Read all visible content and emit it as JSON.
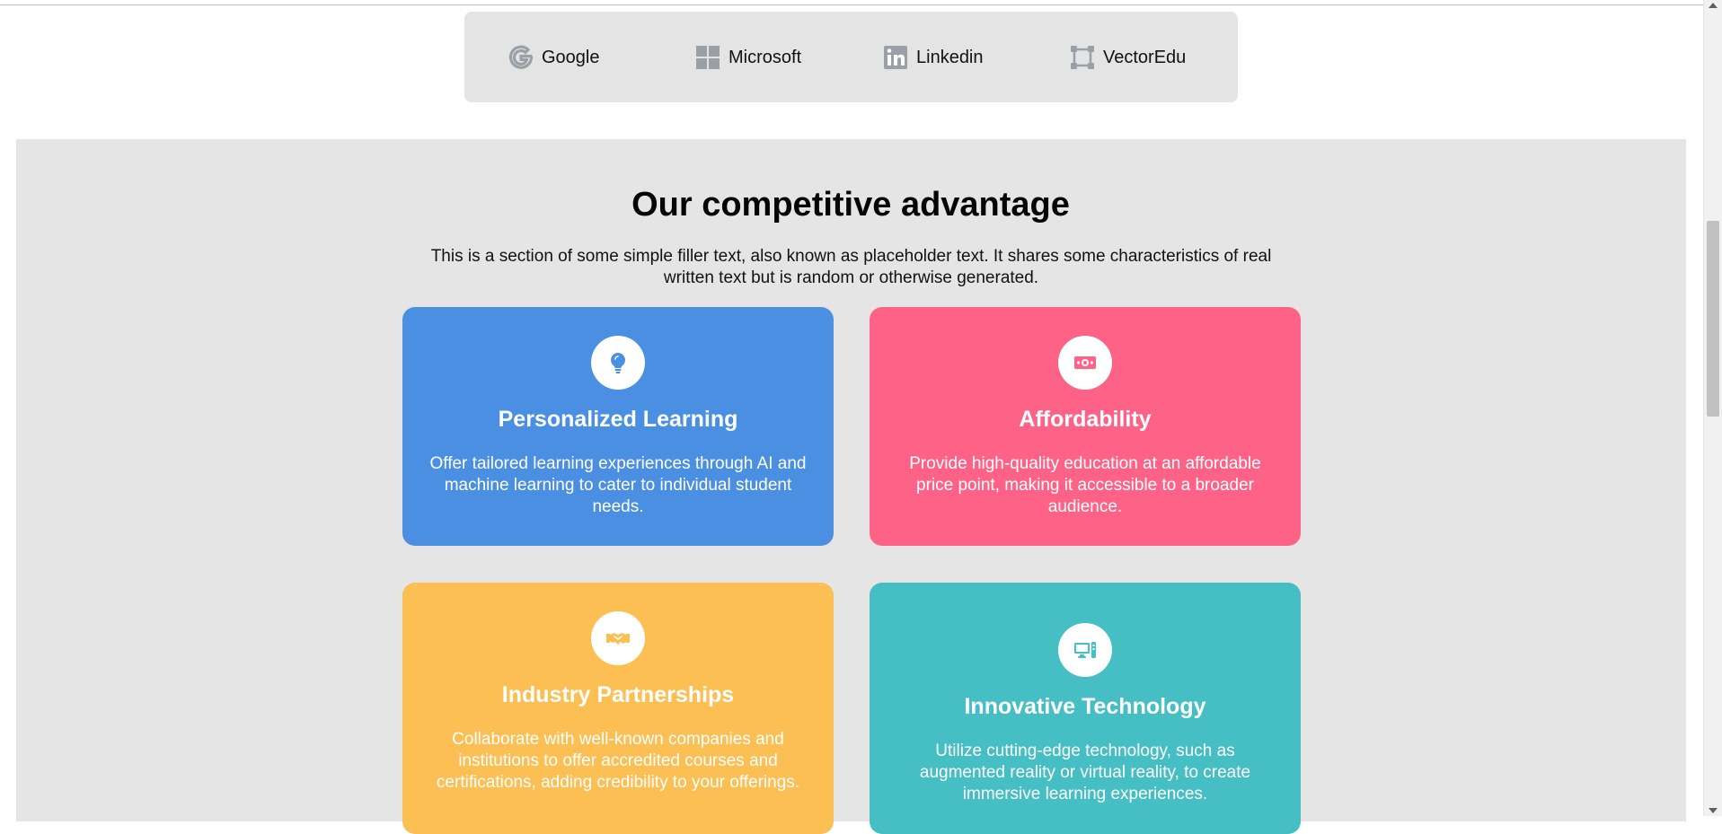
{
  "logos": [
    {
      "name": "Google",
      "icon": "google-icon"
    },
    {
      "name": "Microsoft",
      "icon": "microsoft-icon"
    },
    {
      "name": "Linkedin",
      "icon": "linkedin-icon"
    },
    {
      "name": "VectorEdu",
      "icon": "vector-square-icon"
    }
  ],
  "section": {
    "title": "Our competitive advantage",
    "intro": "This is a section of some simple filler text, also known as placeholder text. It shares some characteristics of real written text but is random or otherwise generated."
  },
  "cards": [
    {
      "title": "Personalized Learning",
      "text": "Offer tailored learning experiences through AI and machine learning to cater to individual student needs.",
      "icon": "lightbulb-icon",
      "color": "#4a8fe2"
    },
    {
      "title": "Affordability",
      "text": "Provide high-quality education at an affordable price point, making it accessible to a broader audience.",
      "icon": "money-bill-icon",
      "color": "#ff6287"
    },
    {
      "title": "Industry Partnerships",
      "text": "Collaborate with well-known companies and institutions to offer accredited courses and certifications, adding credibility to your offerings.",
      "icon": "handshake-icon",
      "color": "#fbbf54"
    },
    {
      "title": "Innovative Technology",
      "text": "Utilize cutting-edge technology, such as augmented reality or virtual reality, to create immersive learning experiences.",
      "icon": "computer-icon",
      "color": "#45bec4"
    }
  ]
}
